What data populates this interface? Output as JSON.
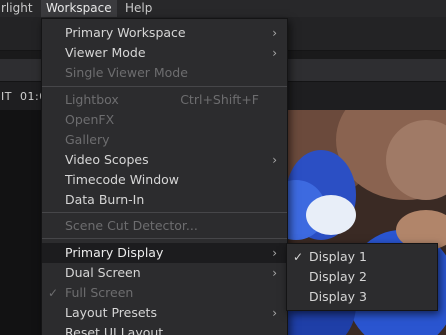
{
  "menubar": {
    "items": [
      {
        "label": "rlight"
      },
      {
        "label": "Workspace"
      },
      {
        "label": "Help"
      }
    ]
  },
  "background": {
    "timecode_label": "IT",
    "timecode_value": "01:0"
  },
  "workspace_menu": {
    "items": [
      {
        "label": "Primary Workspace",
        "submenu": true
      },
      {
        "label": "Viewer Mode",
        "submenu": true
      },
      {
        "label": "Single Viewer Mode",
        "disabled": true
      },
      {
        "label": "Lightbox",
        "shortcut": "Ctrl+Shift+F",
        "disabled": true
      },
      {
        "label": "OpenFX",
        "disabled": true
      },
      {
        "label": "Gallery",
        "disabled": true
      },
      {
        "label": "Video Scopes",
        "submenu": true
      },
      {
        "label": "Timecode Window"
      },
      {
        "label": "Data Burn-In"
      },
      {
        "label": "Scene Cut Detector...",
        "disabled": true
      },
      {
        "label": "Primary Display",
        "submenu": true,
        "highlighted": true
      },
      {
        "label": "Dual Screen",
        "submenu": true
      },
      {
        "label": "Full Screen",
        "disabled": true,
        "checked": true
      },
      {
        "label": "Layout Presets",
        "submenu": true
      },
      {
        "label": "Reset UI Layout"
      }
    ],
    "arrow_glyph": "›",
    "check_glyph": "✓"
  },
  "primary_display_submenu": {
    "items": [
      {
        "label": "Display 1",
        "checked": true
      },
      {
        "label": "Display 2"
      },
      {
        "label": "Display 3"
      }
    ]
  }
}
